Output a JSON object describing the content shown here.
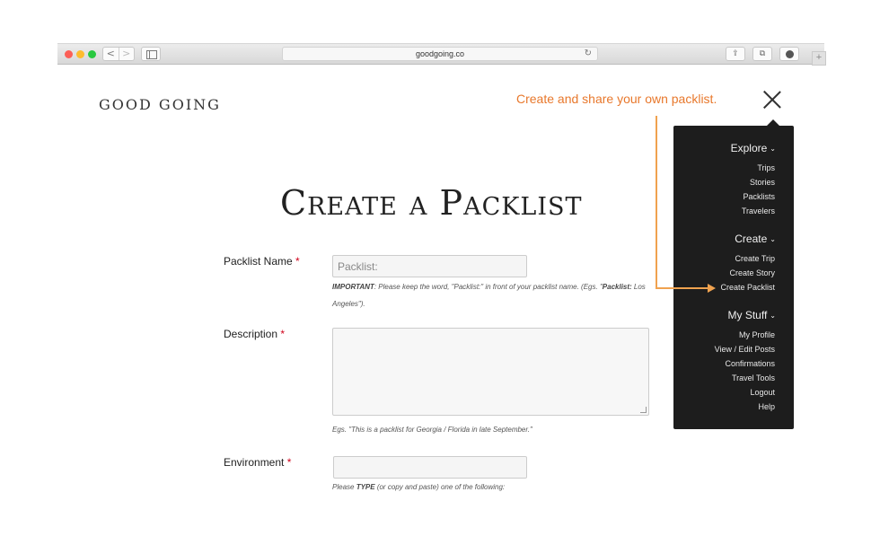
{
  "browser": {
    "url": "goodgoing.co",
    "nav_back": "<",
    "nav_forward": ">",
    "reload_glyph": "↻",
    "new_tab": "+"
  },
  "site": {
    "logo": "GOOD GOING",
    "annotation": "Create and share your own packlist."
  },
  "page_title": "Create a Packlist",
  "form": {
    "name": {
      "label": "Packlist Name",
      "required": "*",
      "placeholder": "Packlist:",
      "help_important": "IMPORTANT",
      "help_line1": ": Please keep the word, \"Packlist:\" in front of your packlist name. (Egs. \"",
      "help_bold": "Packlist:",
      "help_line1_end": " Los",
      "help_line2": "Angeles\")."
    },
    "description": {
      "label": "Description",
      "required": "*",
      "help": "Egs. \"This is a packlist for Georgia / Florida in late September.\""
    },
    "environment": {
      "label": "Environment",
      "required": "*",
      "help_pre": "Please ",
      "help_type": "TYPE",
      "help_post": " (or copy and paste) one of the following:"
    }
  },
  "menu": {
    "explore": {
      "label": "Explore",
      "items": [
        "Trips",
        "Stories",
        "Packlists",
        "Travelers"
      ]
    },
    "create": {
      "label": "Create",
      "items": [
        "Create Trip",
        "Create Story",
        "Create Packlist"
      ]
    },
    "mystuff": {
      "label": "My Stuff",
      "items": [
        "My Profile",
        "View / Edit Posts",
        "Confirmations",
        "Travel Tools",
        "Logout",
        "Help"
      ]
    },
    "chevron": "⌄"
  },
  "colors": {
    "annotation": "#e8782c",
    "panel": "#1d1d1d",
    "required": "#d0021b"
  }
}
